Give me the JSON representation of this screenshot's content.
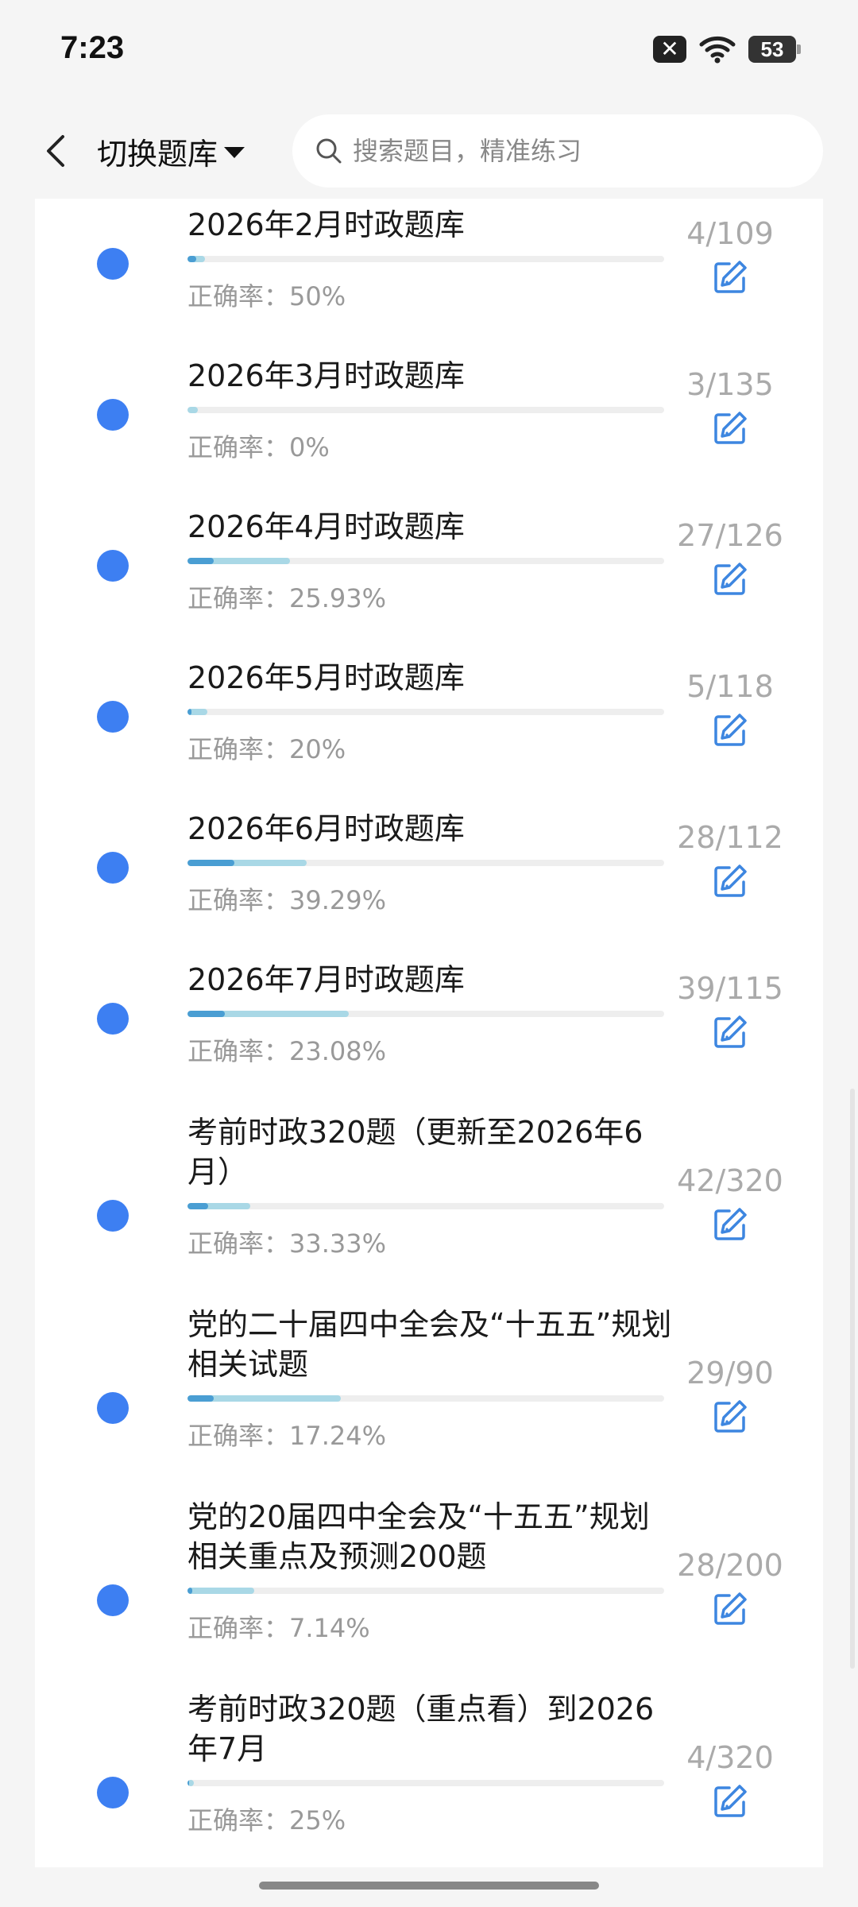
{
  "status_bar": {
    "time": "7:23",
    "notification_icon": "x-close-icon",
    "wifi_icon": "wifi-icon",
    "battery_level": "53"
  },
  "header": {
    "back_icon": "chevron-left-icon",
    "switch_bank_label": "切换题库",
    "search_placeholder": "搜索题目，精准练习"
  },
  "items": [
    {
      "title": "2026年2月时政题库",
      "count": "4/109",
      "accuracy": "正确率：50%",
      "answered": 4,
      "total": 109,
      "accuracy_pct": 50
    },
    {
      "title": "2026年3月时政题库",
      "count": "3/135",
      "accuracy": "正确率：0%",
      "answered": 3,
      "total": 135,
      "accuracy_pct": 0
    },
    {
      "title": "2026年4月时政题库",
      "count": "27/126",
      "accuracy": "正确率：25.93%",
      "answered": 27,
      "total": 126,
      "accuracy_pct": 25.93
    },
    {
      "title": "2026年5月时政题库",
      "count": "5/118",
      "accuracy": "正确率：20%",
      "answered": 5,
      "total": 118,
      "accuracy_pct": 20
    },
    {
      "title": "2026年6月时政题库",
      "count": "28/112",
      "accuracy": "正确率：39.29%",
      "answered": 28,
      "total": 112,
      "accuracy_pct": 39.29
    },
    {
      "title": "2026年7月时政题库",
      "count": "39/115",
      "accuracy": "正确率：23.08%",
      "answered": 39,
      "total": 115,
      "accuracy_pct": 23.08
    },
    {
      "title": "考前时政320题（更新至2026年6月）",
      "count": "42/320",
      "accuracy": "正确率：33.33%",
      "answered": 42,
      "total": 320,
      "accuracy_pct": 33.33
    },
    {
      "title": "党的二十届四中全会及“十五五”规划相关试题",
      "count": "29/90",
      "accuracy": "正确率：17.24%",
      "answered": 29,
      "total": 90,
      "accuracy_pct": 17.24
    },
    {
      "title": "党的20届四中全会及“十五五”规划相关重点及预测200题",
      "count": "28/200",
      "accuracy": "正确率：7.14%",
      "answered": 28,
      "total": 200,
      "accuracy_pct": 7.14
    },
    {
      "title": "考前时政320题（重点看）到2026年7月",
      "count": "4/320",
      "accuracy": "正确率：25%",
      "answered": 4,
      "total": 320,
      "accuracy_pct": 25
    }
  ],
  "colors": {
    "dot": "#3d7ff2",
    "progress_total": "#a9d8e6",
    "progress_correct": "#4a9ed3",
    "edit_icon": "#3d86e0"
  },
  "edit_icon_name": "edit-icon"
}
